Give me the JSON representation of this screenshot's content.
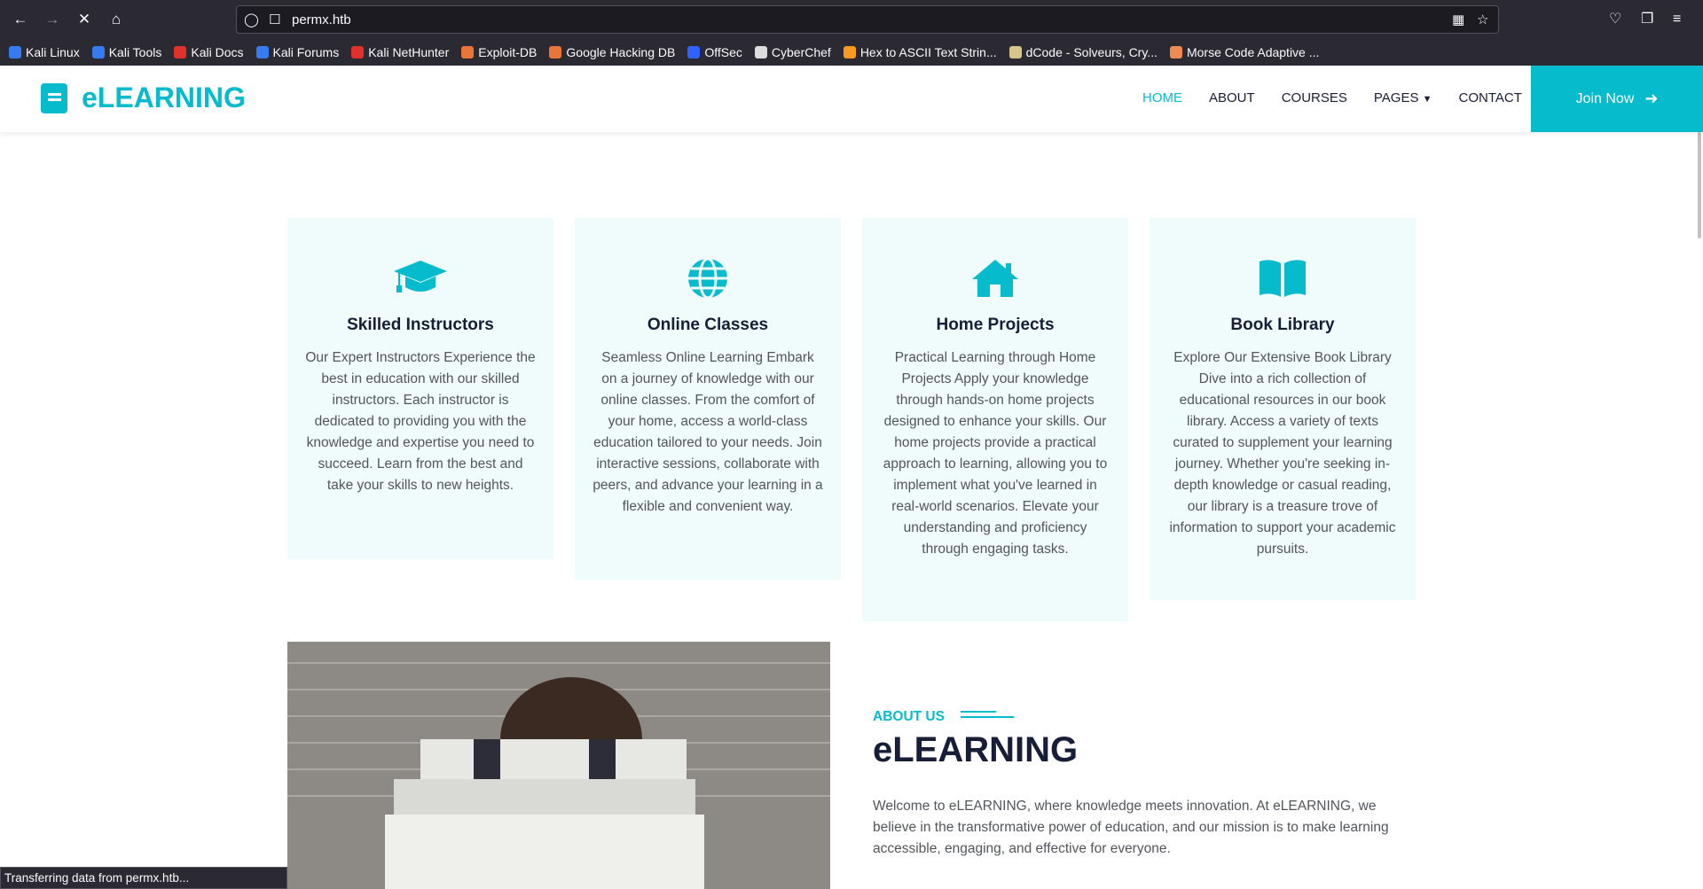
{
  "browser": {
    "url": "permx.htb",
    "bookmarks": [
      {
        "label": "Kali Linux",
        "color": "#367bf0"
      },
      {
        "label": "Kali Tools",
        "color": "#367bf0"
      },
      {
        "label": "Kali Docs",
        "color": "#e0322a"
      },
      {
        "label": "Kali Forums",
        "color": "#367bf0"
      },
      {
        "label": "Kali NetHunter",
        "color": "#e0322a"
      },
      {
        "label": "Exploit-DB",
        "color": "#e8763a"
      },
      {
        "label": "Google Hacking DB",
        "color": "#e8763a"
      },
      {
        "label": "OffSec",
        "color": "#2f63ff"
      },
      {
        "label": "CyberChef",
        "color": "#dddddd"
      },
      {
        "label": "Hex to ASCII Text Strin...",
        "color": "#f79a1f"
      },
      {
        "label": "dCode - Solveurs, Cry...",
        "color": "#d7c58c"
      },
      {
        "label": "Morse Code Adaptive ...",
        "color": "#ef8a52"
      }
    ],
    "status": "Transferring data from permx.htb..."
  },
  "site": {
    "logo": "eLEARNING",
    "menu": [
      "HOME",
      "ABOUT",
      "COURSES",
      "PAGES",
      "CONTACT"
    ],
    "join": "Join Now"
  },
  "cards": [
    {
      "icon": "graduation-cap-icon",
      "title": "Skilled Instructors",
      "text": "Our Expert Instructors Experience the best in education with our skilled instructors. Each instructor is dedicated to providing you with the knowledge and expertise you need to succeed. Learn from the best and take your skills to new heights."
    },
    {
      "icon": "globe-icon",
      "title": "Online Classes",
      "text": "Seamless Online Learning Embark on a journey of knowledge with our online classes. From the comfort of your home, access a world-class education tailored to your needs. Join interactive sessions, collaborate with peers, and advance your learning in a flexible and convenient way."
    },
    {
      "icon": "home-icon",
      "title": "Home Projects",
      "text": "Practical Learning through Home Projects Apply your knowledge through hands-on home projects designed to enhance your skills. Our home projects provide a practical approach to learning, allowing you to implement what you've learned in real-world scenarios. Elevate your understanding and proficiency through engaging tasks."
    },
    {
      "icon": "book-open-icon",
      "title": "Book Library",
      "text": "Explore Our Extensive Book Library Dive into a rich collection of educational resources in our book library. Access a variety of texts curated to supplement your learning journey. Whether you're seeking in-depth knowledge or casual reading, our library is a treasure trove of information to support your academic pursuits."
    }
  ],
  "about": {
    "label": "ABOUT US",
    "title": "eLEARNING",
    "text": "Welcome to eLEARNING, where knowledge meets innovation. At eLEARNING, we believe in the transformative power of education, and our mission is to make learning accessible, engaging, and effective for everyone."
  },
  "colors": {
    "accent": "#06bbcc",
    "dark": "#181d38",
    "card_bg": "#f0fbfc"
  }
}
